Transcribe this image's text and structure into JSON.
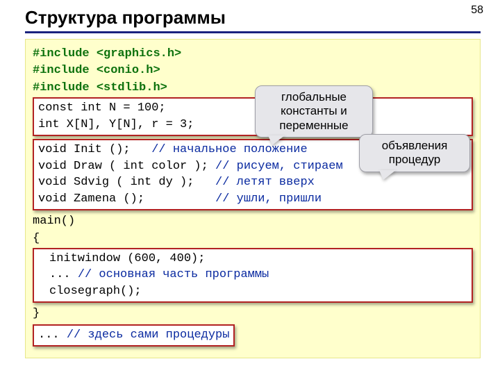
{
  "page_number": "58",
  "title": "Структура программы",
  "callouts": [
    "глобальные константы и переменные",
    "объявления процедур"
  ],
  "code": {
    "includes": [
      {
        "kw": "#include",
        "hdr": "<graphics.h>"
      },
      {
        "kw": "#include",
        "hdr": "<conio.h>"
      },
      {
        "kw": "#include",
        "hdr": "<stdlib.h>"
      }
    ],
    "consts": [
      "const int N = 100;",
      "int X[N], Y[N], r = 3;"
    ],
    "decls": [
      {
        "sig": "void Init ();",
        "cm": "// начальное положение"
      },
      {
        "sig": "void Draw ( int color );",
        "cm": "// рисуем, стираем"
      },
      {
        "sig": "void Sdvig ( int dy );",
        "cm": "// летят вверх"
      },
      {
        "sig": "void Zamena ();",
        "cm": "// ушли, пришли"
      }
    ],
    "main": [
      "main()",
      "{",
      "}"
    ],
    "main_body": {
      "0": "initwindow (600, 400);",
      "1a": "...",
      "1b": "// основная часть программы",
      "2": "closegraph();"
    },
    "procs": {
      "a": "...",
      "b": "// здесь сами процедуры"
    }
  }
}
